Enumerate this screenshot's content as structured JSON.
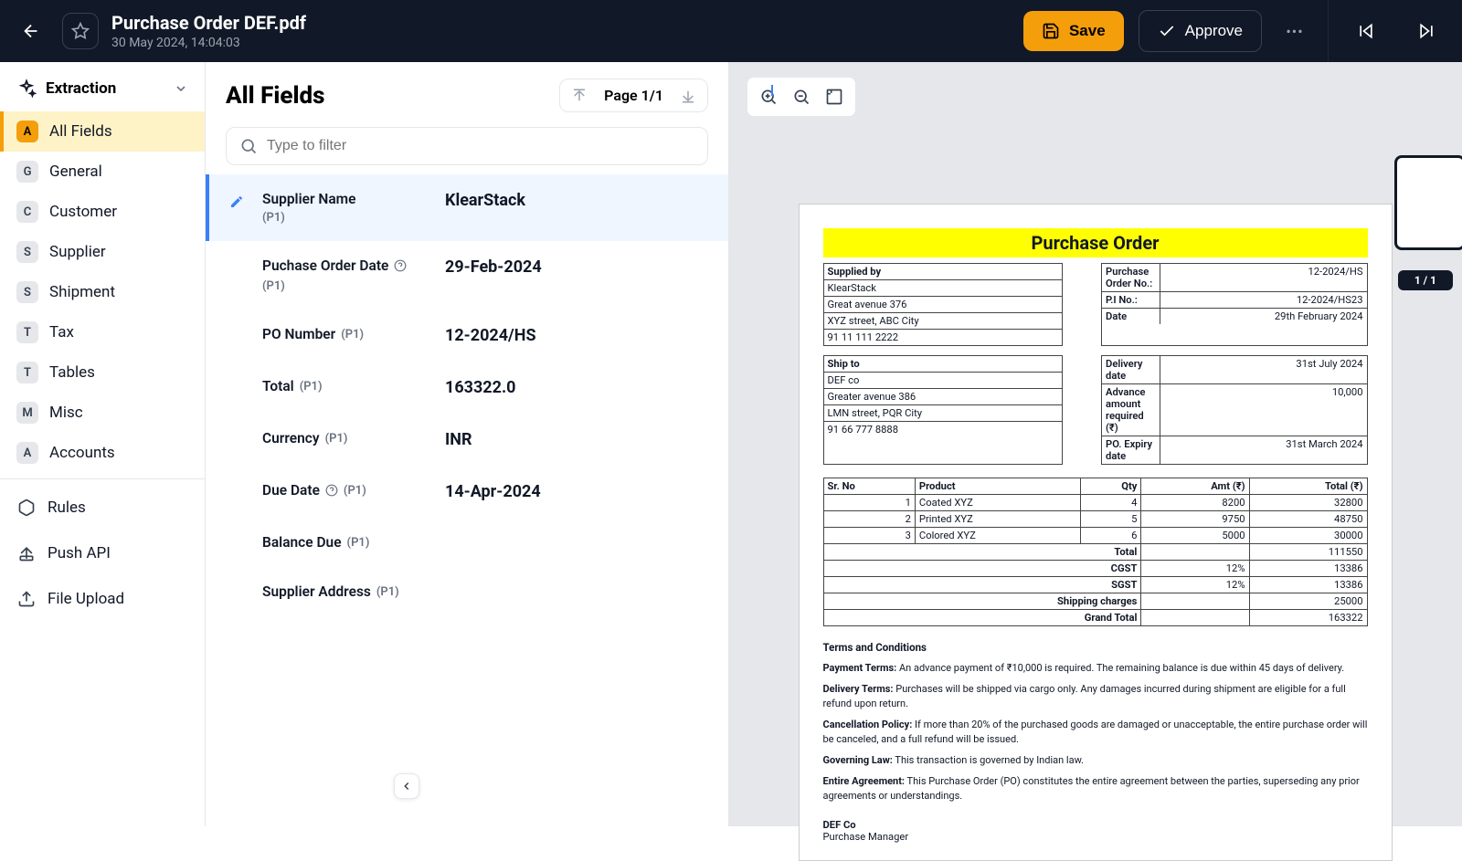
{
  "header": {
    "title": "Purchase Order DEF.pdf",
    "date": "30 May 2024, 14:04:03",
    "save": "Save",
    "approve": "Approve"
  },
  "sidebar": {
    "section_label": "Extraction",
    "items": [
      {
        "badge": "A",
        "label": "All Fields",
        "active": true
      },
      {
        "badge": "G",
        "label": "General"
      },
      {
        "badge": "C",
        "label": "Customer"
      },
      {
        "badge": "S",
        "label": "Supplier"
      },
      {
        "badge": "S",
        "label": "Shipment"
      },
      {
        "badge": "T",
        "label": "Tax"
      },
      {
        "badge": "T",
        "label": "Tables"
      },
      {
        "badge": "M",
        "label": "Misc"
      },
      {
        "badge": "A",
        "label": "Accounts"
      }
    ],
    "tools": [
      {
        "label": "Rules"
      },
      {
        "label": "Push API"
      },
      {
        "label": "File Upload"
      }
    ]
  },
  "mid": {
    "title": "All Fields",
    "page_label": "Page 1/1",
    "filter_placeholder": "Type to filter",
    "fields": [
      {
        "label": "Supplier Name",
        "p": "(P1)",
        "value": "KlearStack",
        "active": true,
        "edit": true
      },
      {
        "label": "Puchase Order Date",
        "p": "(P1)",
        "value": "29-Feb-2024",
        "help": true
      },
      {
        "label": "PO Number",
        "p": "(P1)",
        "value": "12-2024/HS"
      },
      {
        "label": "Total",
        "p": "(P1)",
        "value": "163322.0"
      },
      {
        "label": "Currency",
        "p": "(P1)",
        "value": "INR"
      },
      {
        "label": "Due Date",
        "p": "(P1)",
        "value": "14-Apr-2024",
        "help": true
      },
      {
        "label": "Balance Due",
        "p": "(P1)",
        "value": ""
      },
      {
        "label": "Supplier Address",
        "p": "(P1)",
        "value": ""
      }
    ]
  },
  "thumb_label": "1 / 1",
  "doc": {
    "banner": "Purchase Order",
    "supplied_by_head": "Supplied by",
    "supplier": [
      "KlearStack",
      "Great avenue 376",
      "XYZ street, ABC City",
      "91 11 111 2222"
    ],
    "po_meta": [
      {
        "k": "Purchase Order No.:",
        "v": "12-2024/HS"
      },
      {
        "k": "P.I No.:",
        "v": "12-2024/HS23"
      },
      {
        "k": "Date",
        "v": "29th February 2024"
      }
    ],
    "ship_to_head": "Ship to",
    "ship_to": [
      "DEF co",
      "Greater avenue 386",
      "LMN street, PQR City",
      "91 66 777 8888"
    ],
    "delivery_meta": [
      {
        "k": "Delivery date",
        "v": "31st July 2024"
      },
      {
        "k": "Advance amount required (₹)",
        "v": "10,000"
      },
      {
        "k": "PO. Expiry date",
        "v": "31st March 2024"
      }
    ],
    "items_head": [
      "Sr. No",
      "Product",
      "Qty",
      "Amt (₹)",
      "Total (₹)"
    ],
    "items": [
      {
        "n": "1",
        "p": "Coated XYZ",
        "q": "4",
        "a": "8200",
        "t": "32800"
      },
      {
        "n": "2",
        "p": "Printed XYZ",
        "q": "5",
        "a": "9750",
        "t": "48750"
      },
      {
        "n": "3",
        "p": "Colored XYZ",
        "q": "6",
        "a": "5000",
        "t": "30000"
      }
    ],
    "totals": [
      {
        "k": "Total",
        "v": "111550"
      },
      {
        "k": "CGST",
        "p": "12%",
        "v": "13386"
      },
      {
        "k": "SGST",
        "p": "12%",
        "v": "13386"
      },
      {
        "k": "Shipping charges",
        "v": "25000"
      },
      {
        "k": "Grand Total",
        "v": "163322"
      }
    ],
    "tc_head": "Terms and Conditions",
    "tc": [
      {
        "b": "Payment Terms:",
        "t": " An advance payment of ₹10,000 is required. The remaining balance is due within 45 days of delivery."
      },
      {
        "b": "Delivery Terms:",
        "t": " Purchases will be shipped via cargo only. Any damages incurred during shipment are eligible for a full refund upon return."
      },
      {
        "b": "Cancellation Policy:",
        "t": " If more than 20% of the purchased goods are damaged or unacceptable, the entire purchase order will be canceled, and a full refund will be issued."
      },
      {
        "b": "Governing Law:",
        "t": " This transaction is governed by Indian law."
      },
      {
        "b": "Entire Agreement:",
        "t": " This Purchase Order (PO) constitutes the entire agreement between the parties, superseding any prior agreements or understandings."
      }
    ],
    "signer1": "DEF Co",
    "signer2": "Purchase Manager"
  }
}
